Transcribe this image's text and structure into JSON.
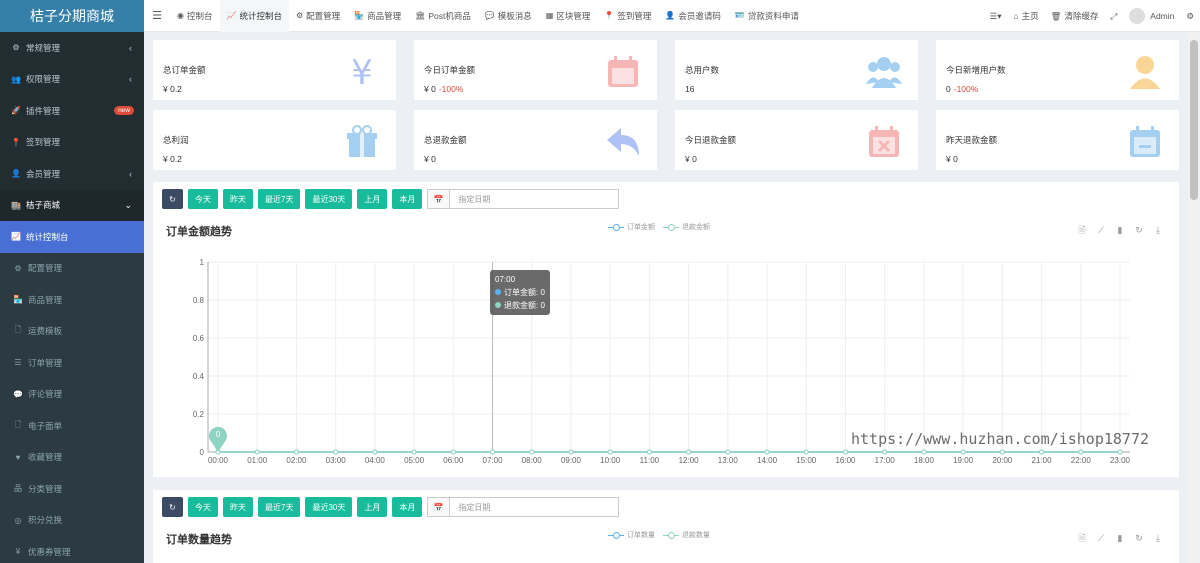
{
  "sidebar": {
    "logo": "桔子分期商城",
    "items": [
      {
        "icon": "cogs-icon",
        "glyph": "⚙",
        "label": "常规管理",
        "chevron": "‹",
        "state": ""
      },
      {
        "icon": "users-icon",
        "glyph": "👥",
        "label": "权限管理",
        "chevron": "‹",
        "state": ""
      },
      {
        "icon": "rocket-icon",
        "glyph": "🚀",
        "label": "插件管理",
        "badge": "new",
        "state": ""
      },
      {
        "icon": "map-marker-icon",
        "glyph": "📍",
        "label": "签到管理",
        "state": ""
      },
      {
        "icon": "user-circle-icon",
        "glyph": "👤",
        "label": "会员管理",
        "chevron": "‹",
        "state": ""
      },
      {
        "icon": "shop-icon",
        "glyph": "🏬",
        "label": "桔子商城",
        "chevron": "⌄",
        "state": "open"
      },
      {
        "icon": "chart-line-icon",
        "glyph": "📈",
        "label": "统计控制台",
        "state": "active"
      },
      {
        "icon": "cog-icon",
        "glyph": "⚙",
        "label": "配置管理",
        "state": "sub"
      },
      {
        "icon": "store-icon",
        "glyph": "🏪",
        "label": "商品管理",
        "state": "sub"
      },
      {
        "icon": "file-icon",
        "glyph": "🗋",
        "label": "运费模板",
        "state": "sub"
      },
      {
        "icon": "list-icon",
        "glyph": "☰",
        "label": "订单管理",
        "state": "sub"
      },
      {
        "icon": "comment-icon",
        "glyph": "💬",
        "label": "评论管理",
        "state": "sub"
      },
      {
        "icon": "file-text-icon",
        "glyph": "🗋",
        "label": "电子面单",
        "state": "sub"
      },
      {
        "icon": "heart-icon",
        "glyph": "♥",
        "label": "收藏管理",
        "state": "sub"
      },
      {
        "icon": "sitemap-icon",
        "glyph": "品",
        "label": "分类管理",
        "state": "sub"
      },
      {
        "icon": "exchange-icon",
        "glyph": "◎",
        "label": "积分兑换",
        "state": "sub"
      },
      {
        "icon": "yen-icon",
        "glyph": "¥",
        "label": "优惠券管理",
        "state": "sub"
      }
    ]
  },
  "topbar": {
    "toggle_glyph": "☰",
    "tabs": [
      {
        "icon": "dashboard-icon",
        "glyph": "◉",
        "label": "控制台",
        "active": false
      },
      {
        "icon": "chart-line-icon",
        "glyph": "📈",
        "label": "统计控制台",
        "active": true
      },
      {
        "icon": "cog-icon",
        "glyph": "⚙",
        "label": "配置管理",
        "active": false
      },
      {
        "icon": "store-icon",
        "glyph": "🏪",
        "label": "商品管理",
        "active": false
      },
      {
        "icon": "bank-icon",
        "glyph": "🏛",
        "label": "Post机商品",
        "active": false
      },
      {
        "icon": "comment-icon",
        "glyph": "💬",
        "label": "模板消息",
        "active": false
      },
      {
        "icon": "th-icon",
        "glyph": "▦",
        "label": "区块管理",
        "active": false
      },
      {
        "icon": "map-marker-icon",
        "glyph": "📍",
        "label": "签到管理",
        "active": false
      },
      {
        "icon": "user-icon",
        "glyph": "👤",
        "label": "会员邀请码",
        "active": false
      },
      {
        "icon": "id-card-icon",
        "glyph": "🪪",
        "label": "贷款资料申请",
        "active": false
      }
    ],
    "right": {
      "menu_glyph": "☰▾",
      "home_glyph": "⌂",
      "home": "主页",
      "trash_glyph": "🗑",
      "clear_cache": "清除缓存",
      "fullscreen_glyph": "⤢",
      "username": "Admin",
      "settings_glyph": "⚙"
    }
  },
  "cards": [
    {
      "label": "总订单金额",
      "value": "¥ 0.2",
      "pct": "",
      "icon": "yen-icon",
      "color": "#6e8ff0"
    },
    {
      "label": "今日订单金额",
      "value": "¥ 0",
      "pct": "-100%",
      "icon": "calendar-icon",
      "color": "#f07c7c"
    },
    {
      "label": "总用户数",
      "value": "16",
      "pct": "",
      "icon": "users-icon",
      "color": "#5aa9e6"
    },
    {
      "label": "今日新增用户数",
      "value": "0",
      "pct": "-100%",
      "icon": "user-icon",
      "color": "#f5b342"
    },
    {
      "label": "总利润",
      "value": "¥ 0.2",
      "pct": "",
      "icon": "gift-icon",
      "color": "#5aa9e6"
    },
    {
      "label": "总退款金额",
      "value": "¥ 0",
      "pct": "",
      "icon": "reply-icon",
      "color": "#6e8ff0"
    },
    {
      "label": "今日退款金额",
      "value": "¥ 0",
      "pct": "",
      "icon": "calendar-times-icon",
      "color": "#f07c7c"
    },
    {
      "label": "昨天退款金额",
      "value": "¥ 0",
      "pct": "",
      "icon": "calendar-minus-icon",
      "color": "#5aa9e6"
    }
  ],
  "filters": {
    "refresh_glyph": "↻",
    "buttons": [
      "今天",
      "昨天",
      "最近7天",
      "最近30天",
      "上月",
      "本月"
    ],
    "calendar_glyph": "📅",
    "date_placeholder": "指定日期"
  },
  "panel1": {
    "title": "订单金额趋势",
    "legend": [
      {
        "name": "订单金额",
        "color": "#5ab1ef"
      },
      {
        "name": "退款金额",
        "color": "#8fd3c2"
      }
    ],
    "tool_glyphs": [
      "🗎",
      "⟋",
      "▮",
      "↻",
      "⤓"
    ]
  },
  "panel2": {
    "title": "订单数量趋势",
    "legend": [
      {
        "name": "订单数量",
        "color": "#5ab1ef"
      },
      {
        "name": "退款数量",
        "color": "#8fd3c2"
      }
    ],
    "tool_glyphs": [
      "🗎",
      "⟋",
      "▮",
      "↻",
      "⤓"
    ]
  },
  "chart_data": {
    "type": "line",
    "title": "订单金额趋势",
    "categories": [
      "00:00",
      "01:00",
      "02:00",
      "03:00",
      "04:00",
      "05:00",
      "06:00",
      "07:00",
      "08:00",
      "09:00",
      "10:00",
      "11:00",
      "12:00",
      "13:00",
      "14:00",
      "15:00",
      "16:00",
      "17:00",
      "18:00",
      "19:00",
      "20:00",
      "21:00",
      "22:00",
      "23:00"
    ],
    "series": [
      {
        "name": "订单金额",
        "color": "#5ab1ef",
        "values": [
          0,
          0,
          0,
          0,
          0,
          0,
          0,
          0,
          0,
          0,
          0,
          0,
          0,
          0,
          0,
          0,
          0,
          0,
          0,
          0,
          0,
          0,
          0,
          0
        ]
      },
      {
        "name": "退款金额",
        "color": "#8fd3c2",
        "values": [
          0,
          0,
          0,
          0,
          0,
          0,
          0,
          0,
          0,
          0,
          0,
          0,
          0,
          0,
          0,
          0,
          0,
          0,
          0,
          0,
          0,
          0,
          0,
          0
        ]
      }
    ],
    "ylim": [
      0,
      1
    ],
    "yticks": [
      "0",
      "0.2",
      "0.4",
      "0.6",
      "0.8",
      "1"
    ],
    "grid": true,
    "legend_position": "top-center",
    "markpoint_label": "0",
    "tooltip": {
      "category": "07:00",
      "lines": [
        "订单金额: 0",
        "退款金额: 0"
      ]
    }
  },
  "watermark": "https://www.huzhan.com/ishop18772"
}
